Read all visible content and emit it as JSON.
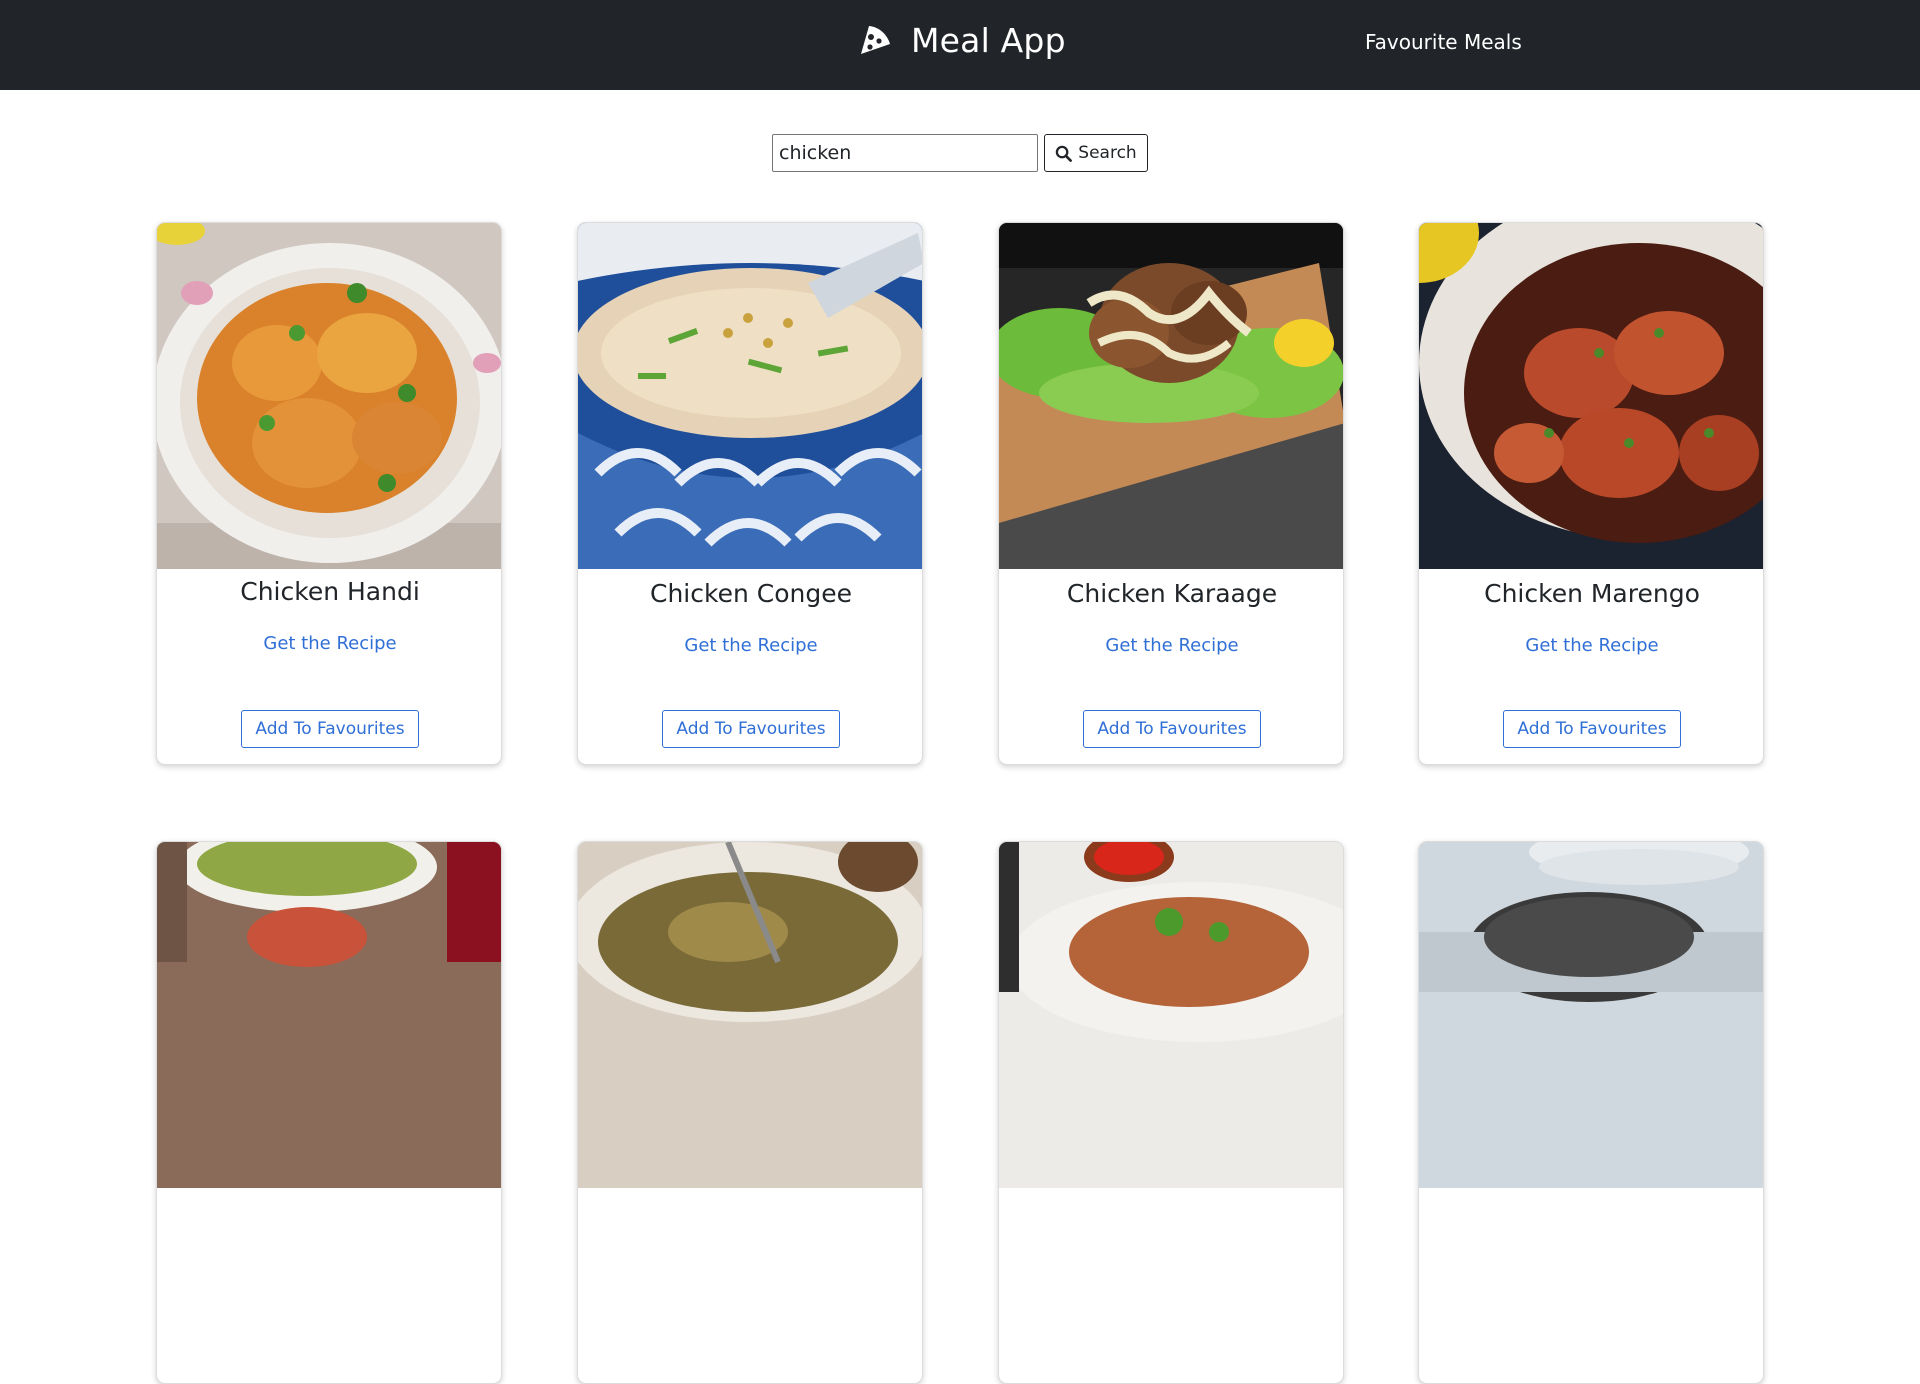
{
  "navbar": {
    "brand_icon": "pizza-slice-icon",
    "brand": "Meal App",
    "favourites_link": "Favourite Meals"
  },
  "search": {
    "value": "chicken",
    "button_icon": "search-icon",
    "button_label": "Search"
  },
  "colors": {
    "navbar_bg": "#212529",
    "link": "#2f6fd6"
  },
  "meals": [
    {
      "name": "Chicken Handi",
      "recipe_link": "Get the Recipe",
      "fav_button": "Add To Favourites"
    },
    {
      "name": "Chicken Congee",
      "recipe_link": "Get the Recipe",
      "fav_button": "Add To Favourites"
    },
    {
      "name": "Chicken Karaage",
      "recipe_link": "Get the Recipe",
      "fav_button": "Add To Favourites"
    },
    {
      "name": "Chicken Marengo",
      "recipe_link": "Get the Recipe",
      "fav_button": "Add To Favourites"
    }
  ]
}
